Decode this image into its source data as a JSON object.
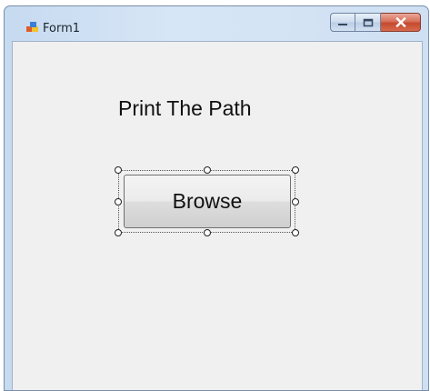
{
  "window": {
    "title": "Form1",
    "title_icon": "winforms-app-icon",
    "controls": {
      "minimize_icon": "minimize-icon",
      "maximize_icon": "maximize-icon",
      "close_icon": "close-icon"
    }
  },
  "form": {
    "label_text": "Print The Path",
    "button_label": "Browse",
    "button_selected_in_designer": true
  },
  "colors": {
    "frame": "#c6daf0",
    "client_background": "#f0f0f0",
    "close_button": "#c44a2f"
  }
}
